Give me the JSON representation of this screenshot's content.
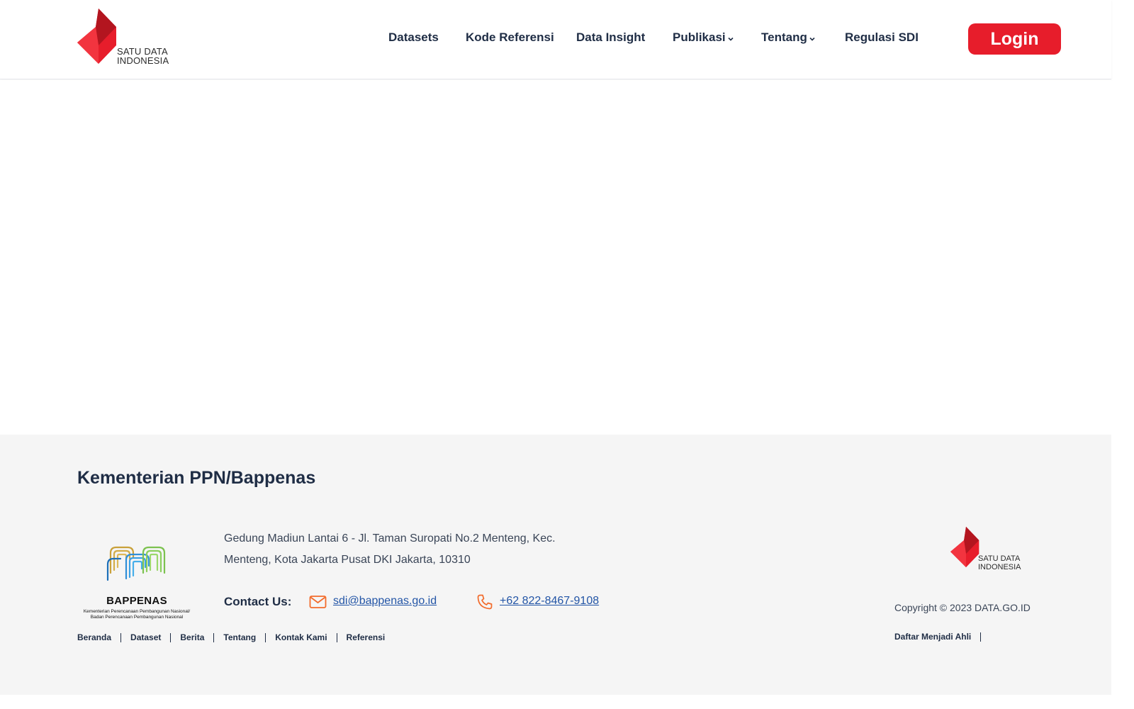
{
  "header": {
    "logo_line1": "SATU DATA",
    "logo_line2": "INDONESIA",
    "nav": {
      "datasets": "Datasets",
      "kode_referensi": "Kode Referensi",
      "data_insight": "Data Insight",
      "publikasi": "Publikasi",
      "tentang": "Tentang",
      "regulasi": "Regulasi SDI"
    },
    "login": "Login"
  },
  "footer": {
    "title": "Kementerian PPN/Bappenas",
    "bappenas_name": "BAPPENAS",
    "bappenas_sub_line1": "Kementerian Perencanaan Pembangunan Nasional/",
    "bappenas_sub_line2": "Badan Perencanaan Pembangunan Nasional",
    "address_line1": "Gedung Madiun Lantai 6 - Jl. Taman Suropati No.2 Menteng, Kec.",
    "address_line2": "Menteng, Kota Jakarta Pusat DKI Jakarta, 10310",
    "contact_label": "Contact Us:",
    "email": "sdi@bappenas.go.id",
    "phone": "+62 822-8467-9108",
    "links": {
      "beranda": "Beranda",
      "dataset": "Dataset",
      "berita": "Berita",
      "tentang": "Tentang",
      "kontak": "Kontak Kami",
      "referensi": "Referensi"
    },
    "sdi_line1": "SATU DATA",
    "sdi_line2": "INDONESIA",
    "copyright": "Copyright © 2023 DATA.GO.ID",
    "daftar": "Daftar Menjadi Ahli"
  },
  "colors": {
    "brand_red": "#e71d2b",
    "navy": "#1f2d45",
    "link_blue": "#2355a6",
    "accent_orange": "#f26b2b"
  }
}
